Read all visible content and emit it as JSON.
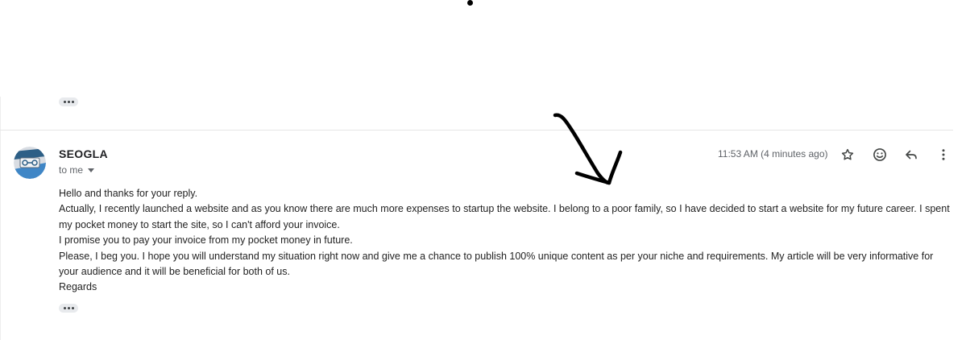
{
  "message": {
    "sender_name": "SEOGLA",
    "recipient_label": "to me",
    "timestamp": "11:53 AM (4 minutes ago)",
    "body": [
      "Hello and thanks for your reply.",
      "Actually, I recently launched a website and as you know there are much more expenses to startup the website. I belong to a poor family, so I have decided to start a website for my future career. I spent my pocket money to start the site, so I can't afford your invoice.",
      "I promise you to pay your invoice from my pocket money in future.",
      "Please, I beg you. I hope you will understand my situation right now and give me a chance to publish 100% unique content as per your niche and requirements. My article will be very informative for your audience and it will be beneficial for both of us.",
      "Regards"
    ]
  },
  "icons": {
    "star": "star-icon",
    "emoji": "emoji-icon",
    "reply": "reply-icon",
    "more": "more-vert-icon",
    "expand": "ellipsis-icon",
    "caret": "caret-down-icon",
    "annotation": "hand-drawn-arrow"
  },
  "colors": {
    "text": "#202124",
    "secondary": "#5f6368",
    "chip": "#e8eaed"
  }
}
